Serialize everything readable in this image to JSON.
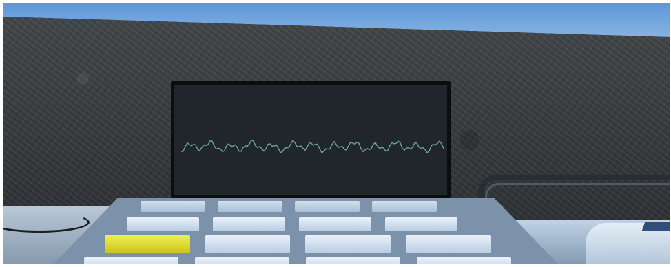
{
  "scene": {
    "description_colors": {
      "sky": "#6f9fd6",
      "wall": "#3a3d40",
      "screen": "#20262b",
      "waveform": "#6fa6a0",
      "key": "#dbe6f2",
      "highlighted_key": "#e3df3a"
    }
  },
  "keypad": {
    "rows": 4,
    "columns": 4,
    "highlighted_key": {
      "row": 3,
      "column": 1
    }
  }
}
